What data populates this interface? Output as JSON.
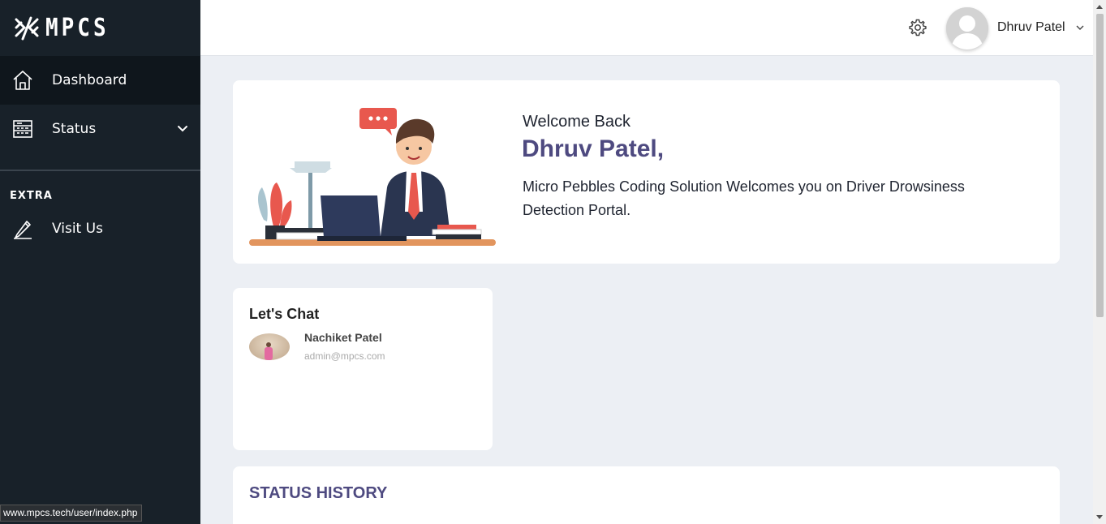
{
  "brand": {
    "name": "MPCS"
  },
  "sidebar": {
    "items": [
      {
        "label": "Dashboard",
        "icon": "home-icon",
        "active": true
      },
      {
        "label": "Status",
        "icon": "server-icon",
        "has_submenu": true
      }
    ],
    "extra_section_title": "EXTRA",
    "extra_items": [
      {
        "label": "Visit Us",
        "icon": "pencil-icon"
      }
    ]
  },
  "topbar": {
    "user_name": "Dhruv Patel"
  },
  "welcome": {
    "greeting": "Welcome Back",
    "name": "Dhruv Patel,",
    "message": "Micro Pebbles Coding Solution Welcomes you on Driver Drowsiness Detection Portal."
  },
  "chat": {
    "title": "Let's Chat",
    "contact": {
      "name": "Nachiket Patel",
      "email": "admin@mpcs.com"
    }
  },
  "status_history": {
    "title": "STATUS HISTORY"
  },
  "browser_status": {
    "url": "www.mpcs.tech/user/index.php"
  },
  "colors": {
    "sidebar_bg": "#182129",
    "sidebar_active": "#0f161c",
    "accent_purple": "#4e4a80",
    "page_bg": "#eceff4"
  }
}
